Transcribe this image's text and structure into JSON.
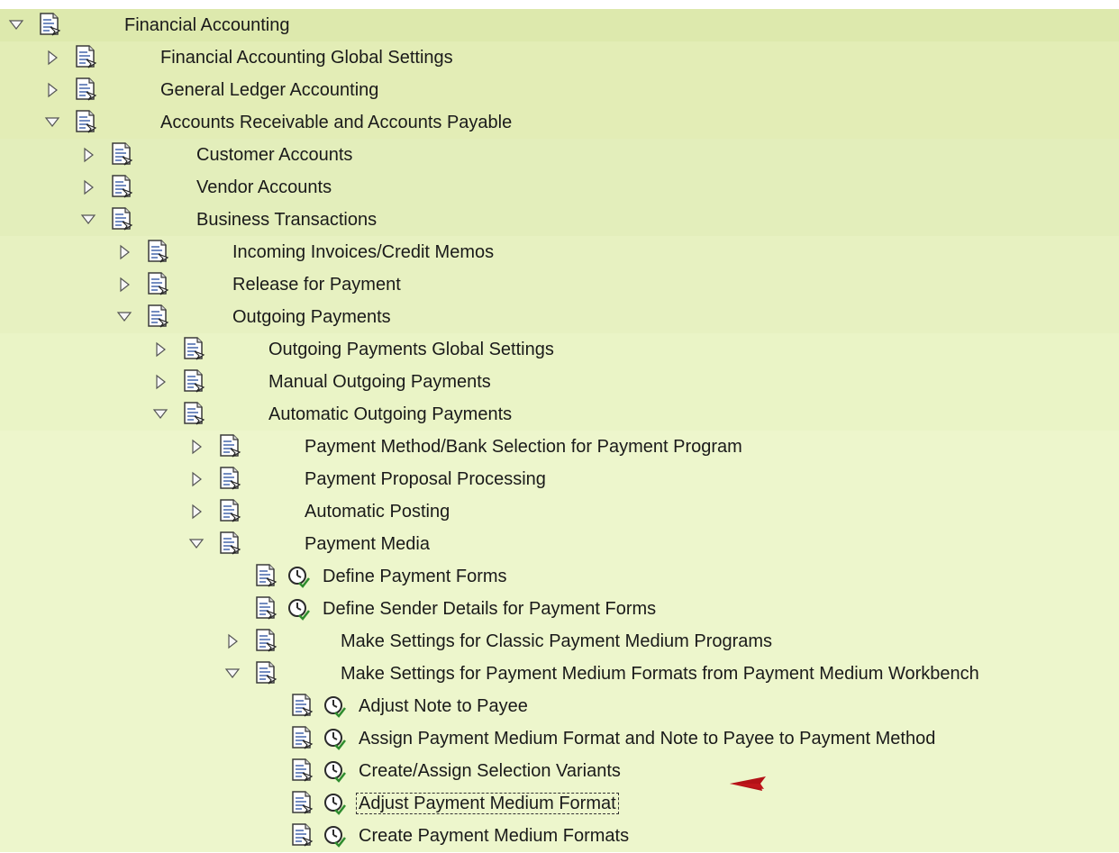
{
  "tree": {
    "rows": [
      {
        "depth": 0,
        "state": "expanded",
        "label": "Financial Accounting"
      },
      {
        "depth": 1,
        "state": "collapsed",
        "label": "Financial Accounting Global Settings"
      },
      {
        "depth": 1,
        "state": "collapsed",
        "label": "General Ledger Accounting"
      },
      {
        "depth": 1,
        "state": "expanded",
        "label": "Accounts Receivable and Accounts Payable"
      },
      {
        "depth": 2,
        "state": "collapsed",
        "label": "Customer Accounts"
      },
      {
        "depth": 2,
        "state": "collapsed",
        "label": "Vendor Accounts"
      },
      {
        "depth": 2,
        "state": "expanded",
        "label": "Business Transactions"
      },
      {
        "depth": 3,
        "state": "collapsed",
        "label": "Incoming Invoices/Credit Memos"
      },
      {
        "depth": 3,
        "state": "collapsed",
        "label": "Release for Payment"
      },
      {
        "depth": 3,
        "state": "expanded",
        "label": "Outgoing Payments"
      },
      {
        "depth": 4,
        "state": "collapsed",
        "label": "Outgoing Payments Global Settings"
      },
      {
        "depth": 4,
        "state": "collapsed",
        "label": "Manual Outgoing Payments"
      },
      {
        "depth": 4,
        "state": "expanded",
        "label": "Automatic Outgoing Payments"
      },
      {
        "depth": 5,
        "state": "collapsed",
        "label": "Payment Method/Bank Selection for Payment Program"
      },
      {
        "depth": 5,
        "state": "collapsed",
        "label": "Payment Proposal Processing"
      },
      {
        "depth": 5,
        "state": "collapsed",
        "label": "Automatic Posting"
      },
      {
        "depth": 5,
        "state": "expanded",
        "label": "Payment Media"
      },
      {
        "depth": 6,
        "state": "activity",
        "label": "Define Payment Forms"
      },
      {
        "depth": 6,
        "state": "activity",
        "label": "Define Sender Details for Payment Forms"
      },
      {
        "depth": 6,
        "state": "collapsed",
        "label": "Make Settings for Classic Payment Medium Programs"
      },
      {
        "depth": 6,
        "state": "expanded",
        "label": "Make Settings for Payment Medium Formats from Payment Medium Workbench"
      },
      {
        "depth": 7,
        "state": "activity",
        "label": "Adjust Note to Payee"
      },
      {
        "depth": 7,
        "state": "activity",
        "label": "Assign Payment Medium Format and Note to Payee to Payment Method"
      },
      {
        "depth": 7,
        "state": "activity",
        "label": "Create/Assign Selection Variants"
      },
      {
        "depth": 7,
        "state": "activity",
        "label": "Adjust Payment Medium Format",
        "selected": true
      },
      {
        "depth": 7,
        "state": "activity",
        "label": "Create Payment Medium Formats"
      }
    ]
  },
  "annotation": {
    "type": "arrow",
    "color": "#c0161b",
    "points_to": "Adjust Payment Medium Format"
  },
  "colors": {
    "row_background": "#e3eebb",
    "text": "#1a1a1a",
    "arrow": "#c0161b"
  },
  "icons": {
    "expanded": "triangle-down-icon",
    "collapsed": "triangle-right-icon",
    "node": "document-icon",
    "activity": "clock-execute-icon"
  }
}
